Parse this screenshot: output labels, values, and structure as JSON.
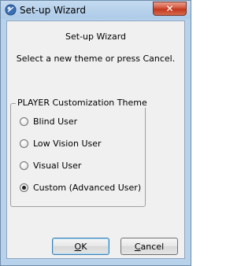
{
  "window": {
    "title": "Set-up Wizard",
    "close_glyph": "✕"
  },
  "dialog": {
    "heading": "Set-up Wizard",
    "instruction": "Select a new theme or press Cancel."
  },
  "theme_group": {
    "legend": "PLAYER Customization Theme",
    "options": [
      {
        "label": "Blind User",
        "checked": false
      },
      {
        "label": "Low Vision User",
        "checked": false
      },
      {
        "label": "Visual  User",
        "checked": false
      },
      {
        "label": "Custom (Advanced User)",
        "checked": true
      }
    ]
  },
  "buttons": {
    "ok_mnemonic": "O",
    "ok_rest": "K",
    "cancel_mnemonic": "C",
    "cancel_rest": "ancel"
  },
  "icons": {
    "app": "wizard-app-icon",
    "close": "close-icon"
  },
  "colors": {
    "title_bar": "#b8d2ec",
    "close_button": "#c2371c",
    "client_bg": "#f0f0f0"
  }
}
